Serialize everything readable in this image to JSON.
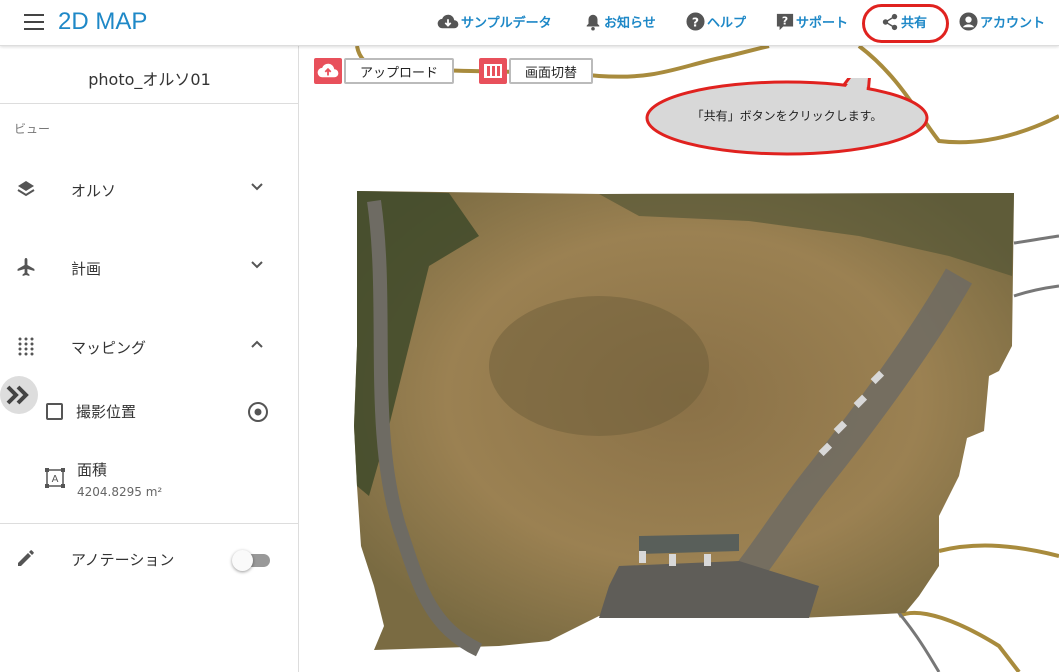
{
  "header": {
    "title": "2D MAP",
    "nav": {
      "sample": "サンプルデータ",
      "notice": "お知らせ",
      "help": "ヘルプ",
      "support": "サポート",
      "share": "共有",
      "account": "アカウント"
    }
  },
  "sidebar": {
    "file_name": "photo_オルソ01",
    "section": "ビュー",
    "items": [
      {
        "label": "オルソ",
        "icon": "layers-icon"
      },
      {
        "label": "計画",
        "icon": "airplane-icon"
      },
      {
        "label": "マッピング",
        "icon": "grid-dots-icon"
      }
    ],
    "mapping": {
      "photo_position": "撮影位置",
      "area_label": "面積",
      "area_value": "4204.8295 m²"
    },
    "annotation": {
      "label": "アノテーション",
      "toggle_on": false
    }
  },
  "toolbar": {
    "upload": "アップロード",
    "switch_screen": "画面切替"
  },
  "callout": {
    "text": "「共有」ボタンをクリックします。"
  },
  "colors": {
    "accent": "#1e88c7",
    "highlight": "#e0221f",
    "tool_icon_bg": "#e8505b"
  }
}
